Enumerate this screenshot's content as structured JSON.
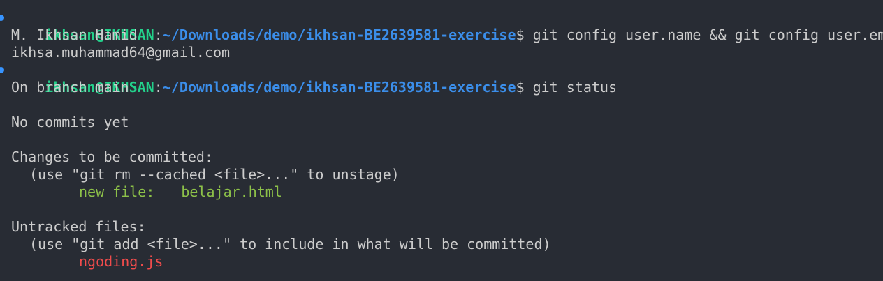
{
  "prompt": {
    "user_host": "ikhsan@IKHSAN",
    "separator": ":",
    "path": "~/Downloads/demo/ikhsan-BE2639581-exercise",
    "symbol": "$"
  },
  "commands": {
    "first": "git config user.name && git config user.email",
    "second": "git status"
  },
  "output": {
    "user_name": "M. Ikhsan Hamid",
    "user_email": "ikhsa.muhammad64@gmail.com",
    "branch_line": "On branch main",
    "no_commits": "No commits yet",
    "changes_header": "Changes to be committed:",
    "changes_hint": "(use \"git rm --cached <file>...\" to unstage)",
    "staged_label": "new file:",
    "staged_file": "belajar.html",
    "untracked_header": "Untracked files:",
    "untracked_hint": "(use \"git add <file>...\" to include in what will be committed)",
    "untracked_file": "ngoding.js"
  },
  "colors": {
    "background": "#282c34",
    "prompt_user": "#23d18b",
    "prompt_path": "#3b8eea",
    "text": "#cccccc",
    "staged": "#8dc149",
    "untracked": "#f14c4c",
    "marker": "#3794ff"
  }
}
